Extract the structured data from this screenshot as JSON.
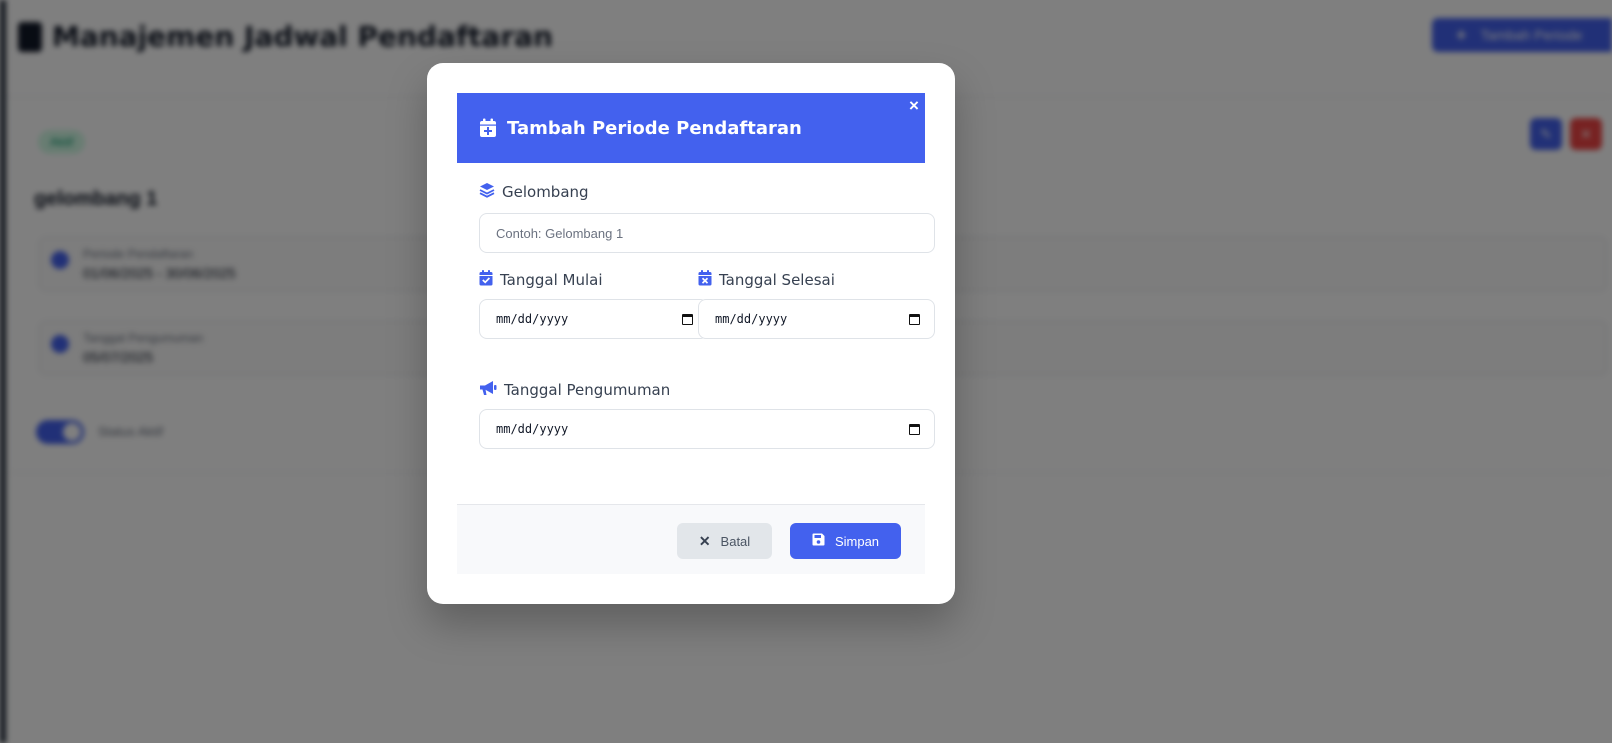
{
  "background": {
    "title": "Manajemen Jadwal Pendaftaran",
    "add_button_label": "Tambah Periode",
    "status_badge": "Aktif",
    "wave_name": "gelombang 1",
    "period_label": "Periode Pendaftaran",
    "period_value": "01/06/2025 - 30/06/2025",
    "announcement_label": "Tanggal Pengumuman",
    "announcement_value": "05/07/2025",
    "toggle_label": "Status Aktif"
  },
  "modal": {
    "title": "Tambah Periode Pendaftaran",
    "close_icon": "×",
    "wave": {
      "label": "Gelombang",
      "placeholder": "Contoh: Gelombang 1",
      "value": ""
    },
    "start_date": {
      "label": "Tanggal Mulai",
      "value": "mm/dd/yyyy"
    },
    "end_date": {
      "label": "Tanggal Selesai",
      "value": "mm/dd/yyyy"
    },
    "announcement_date": {
      "label": "Tanggal Pengumuman",
      "value": "mm/dd/yyyy"
    },
    "cancel_label": "Batal",
    "save_label": "Simpan"
  },
  "icons": {
    "header": "calendar-plus-icon",
    "wave": "layers-icon",
    "start": "calendar-check-icon",
    "end": "calendar-x-icon",
    "announcement": "megaphone-icon",
    "cancel": "x-icon",
    "save": "floppy-disk-icon"
  },
  "colors": {
    "accent": "#4361ee",
    "danger": "#ef4444",
    "overlay": "rgba(0,0,0,0.5)",
    "cancel_bg": "#e2e6ea"
  }
}
